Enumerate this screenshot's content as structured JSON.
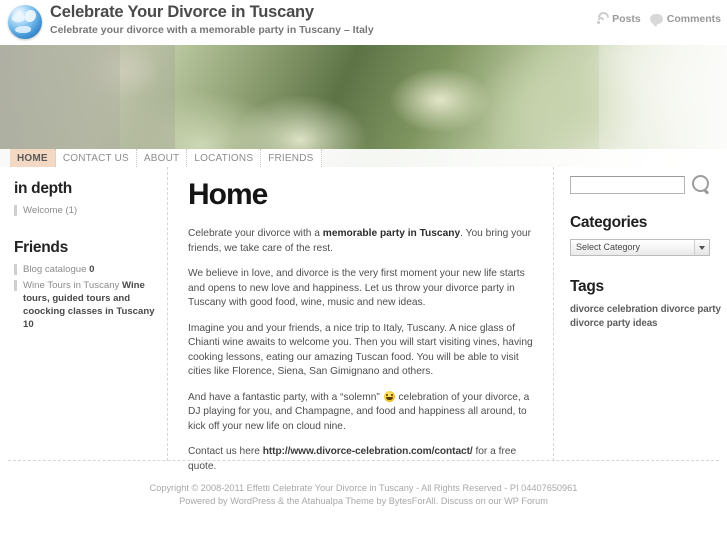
{
  "header": {
    "logo_icon": "globe-icon",
    "title": "Celebrate Your Divorce in Tuscany",
    "tagline": "Celebrate your divorce with a memorable party in Tuscany – Italy",
    "feeds": [
      {
        "icon": "rss-icon",
        "label": "Posts"
      },
      {
        "icon": "comment-bubble-icon",
        "label": "Comments"
      }
    ]
  },
  "nav": {
    "items": [
      {
        "label": "HOME",
        "active": true
      },
      {
        "label": "CONTACT US",
        "active": false
      },
      {
        "label": "ABOUT",
        "active": false
      },
      {
        "label": "LOCATIONS",
        "active": false
      },
      {
        "label": "FRIENDS",
        "active": false
      }
    ],
    "active_bg": "#f3d9c4"
  },
  "sidebar_left": {
    "widget1": {
      "title": "in depth",
      "items": [
        {
          "link": "Welcome",
          "count": "(1)",
          "desc": ""
        }
      ]
    },
    "widget2": {
      "title": "Friends",
      "items": [
        {
          "link": "Blog catalogue",
          "desc": "0"
        },
        {
          "link": "Wine Tours in Tuscany",
          "desc": "Wine tours, guided tours and coocking classes in Tuscany 10"
        }
      ]
    }
  },
  "main": {
    "title": "Home",
    "paragraphs": [
      {
        "parts": [
          {
            "t": "Celebrate your divorce with a ",
            "s": "normal"
          },
          {
            "t": "memorable party in Tuscany",
            "s": "bold"
          },
          {
            "t": ". You bring your friends, we take care of the rest.",
            "s": "normal"
          }
        ]
      },
      {
        "parts": [
          {
            "t": "We believe in love, and divorce is the very first moment your new life starts and opens to new love and happiness. Let us throw your divorce party in Tuscany with good food, wine, music and new ideas.",
            "s": "normal"
          }
        ]
      },
      {
        "parts": [
          {
            "t": "Imagine you and your friends, a nice trip to Italy, Tuscany. A nice glass of Chianti wine awaits to welcome you. Then you will start visiting vines, having cooking lessons, eating our amazing Tuscan food. You will be able to visit cities like Florence, Siena, San Gimignano and others.",
            "s": "normal"
          }
        ]
      },
      {
        "parts": [
          {
            "t": "And have a fantastic party, with a “solemn” ",
            "s": "normal"
          },
          {
            "t": "",
            "s": "emoji"
          },
          {
            "t": " celebration of your divorce, a DJ playing for you, and Champagne, and food and happiness all around, to kick off your new life on cloud nine.",
            "s": "normal"
          }
        ]
      },
      {
        "parts": [
          {
            "t": "Contact us here ",
            "s": "normal"
          },
          {
            "t": "http://www.divorce-celebration.com/contact/",
            "s": "url"
          },
          {
            "t": " for a free quote.",
            "s": "normal"
          }
        ]
      }
    ]
  },
  "sidebar_right": {
    "search": {
      "value": "",
      "placeholder": "",
      "icon": "magnifier-icon"
    },
    "categories": {
      "title": "Categories",
      "selected": "Select Category"
    },
    "tags": {
      "title": "Tags",
      "items": [
        "divorce celebration",
        "divorce party",
        "divorce party ideas"
      ]
    }
  },
  "footer": {
    "line1": "Copyright © 2008-2011 Effetti Celebrate Your Divorce in Tuscany - All Rights Reserved - PI 04407650961",
    "line2_a": "Powered by ",
    "line2_wp": "WordPress",
    "line2_b": " & the ",
    "line2_theme": "Atahualpa Theme",
    "line2_c": " by ",
    "line2_author": "BytesForAll",
    "line2_d": ". Discuss on our ",
    "line2_forum": "WP Forum"
  }
}
